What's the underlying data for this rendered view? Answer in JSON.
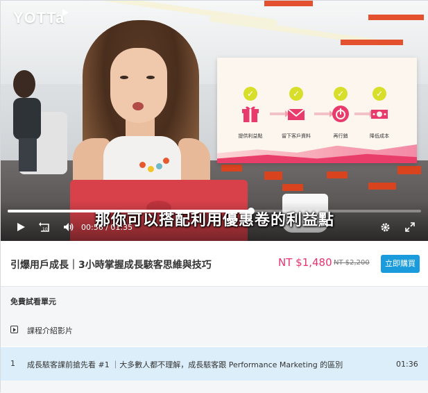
{
  "logo": {
    "text": "YOTTa"
  },
  "video": {
    "subtitle": "那你可以搭配利用優惠卷的利益點",
    "current_time": "00:56",
    "duration": "01:35",
    "progress_fraction": 0.589,
    "overlay_steps": [
      {
        "label": "提供利益點",
        "icon": "gift-icon",
        "color": "#e83a6c"
      },
      {
        "label": "留下客戶資料",
        "icon": "envelope-icon",
        "color": "#e83a6c"
      },
      {
        "label": "再行銷",
        "icon": "power-icon",
        "color": "#e83a6c"
      },
      {
        "label": "降低成本",
        "icon": "money-icon",
        "color": "#e83a6c"
      }
    ]
  },
  "course": {
    "title": "引爆用戶成長｜3小時掌握成長駭客思維與技巧",
    "price": "NT $1,480",
    "original_price": "NT $2,200",
    "buy_label": "立即購買",
    "accent_color": "#e6336f",
    "button_color": "#1a9bdc"
  },
  "free_preview": {
    "title": "免費試看單元",
    "intro": {
      "label": "課程介紹影片",
      "icon": "play-box-icon"
    },
    "lessons": [
      {
        "number": "1",
        "title": "成長駭客課前搶先看 #1 ｜大多數人都不理解，成長駭客跟 Performance Marketing 的區別",
        "duration": "01:36"
      }
    ]
  }
}
